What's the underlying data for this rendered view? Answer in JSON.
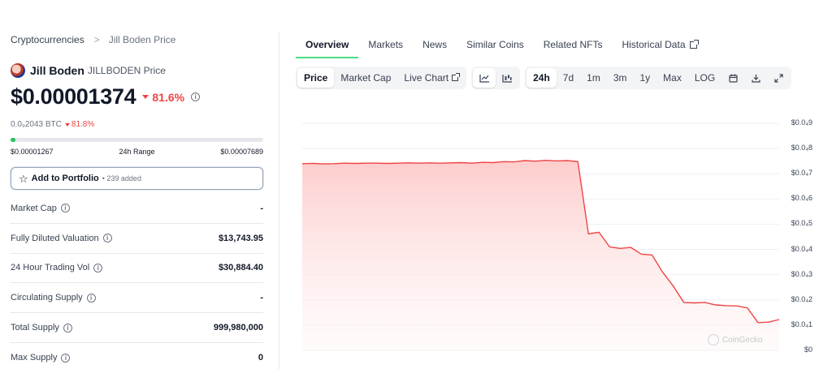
{
  "breadcrumb": {
    "root": "Cryptocurrencies",
    "separator": ">",
    "current": "Jill Boden Price"
  },
  "coin": {
    "name": "Jill Boden",
    "symbol_label": "JILLBODEN Price",
    "icon": "jill-boden-logo"
  },
  "price": {
    "value": "$0.00001374",
    "change": "81.6%",
    "direction": "down"
  },
  "btc": {
    "value": "0.0₉2043 BTC",
    "change": "81.8%"
  },
  "range": {
    "low": "$0.00001267",
    "label": "24h Range",
    "high": "$0.00007689",
    "position_fraction": 0.02
  },
  "portfolio": {
    "label": "Add to Portfolio",
    "count": "• 239 added"
  },
  "stats": [
    {
      "label": "Market Cap",
      "value": "-"
    },
    {
      "label": "Fully Diluted Valuation",
      "value": "$13,743.95"
    },
    {
      "label": "24 Hour Trading Vol",
      "value": "$30,884.40"
    },
    {
      "label": "Circulating Supply",
      "value": "-"
    },
    {
      "label": "Total Supply",
      "value": "999,980,000"
    },
    {
      "label": "Max Supply",
      "value": "0"
    }
  ],
  "tabs": [
    "Overview",
    "Markets",
    "News",
    "Similar Coins",
    "Related NFTs",
    "Historical Data"
  ],
  "chart_type_buttons": [
    "Price",
    "Market Cap",
    "Live Chart"
  ],
  "range_buttons": [
    "24h",
    "7d",
    "1m",
    "3m",
    "1y",
    "Max",
    "LOG"
  ],
  "icons": {
    "line": "line-chart-icon",
    "candle": "candlestick-icon",
    "calendar": "calendar-icon",
    "download": "download-icon",
    "expand": "expand-icon"
  },
  "colors": {
    "accent": "#4ade80",
    "down": "#ef4444",
    "line": "#ef4444",
    "fill": "#fecaca"
  },
  "watermark": "CoinGecko",
  "chart_data": {
    "type": "area",
    "y_tick_labels": [
      "$0.0₄9",
      "$0.0₄8",
      "$0.0₄7",
      "$0.0₄6",
      "$0.0₄5",
      "$0.0₄4",
      "$0.0₄3",
      "$0.0₄2",
      "$0.0₄1",
      "$0"
    ],
    "y_tick_values": [
      9e-05,
      8e-05,
      7e-05,
      6e-05,
      5e-05,
      4e-05,
      3e-05,
      2e-05,
      1e-05,
      0
    ],
    "ylim": [
      0,
      9e-05
    ],
    "grid": true,
    "values": [
      7.4e-05,
      7.41e-05,
      7.39e-05,
      7.4e-05,
      7.42e-05,
      7.41e-05,
      7.42e-05,
      7.42e-05,
      7.41e-05,
      7.42e-05,
      7.43e-05,
      7.42e-05,
      7.43e-05,
      7.42e-05,
      7.43e-05,
      7.44e-05,
      7.42e-05,
      7.45e-05,
      7.44e-05,
      7.48e-05,
      7.47e-05,
      7.52e-05,
      7.5e-05,
      7.53e-05,
      7.51e-05,
      7.52e-05,
      7.48e-05,
      4.62e-05,
      4.68e-05,
      4.1e-05,
      4.04e-05,
      4.08e-05,
      3.81e-05,
      3.78e-05,
      3.1e-05,
      2.55e-05,
      1.9e-05,
      1.88e-05,
      1.9e-05,
      1.8e-05,
      1.77e-05,
      1.76e-05,
      1.68e-05,
      1.1e-05,
      1.12e-05,
      1.22e-05
    ]
  }
}
